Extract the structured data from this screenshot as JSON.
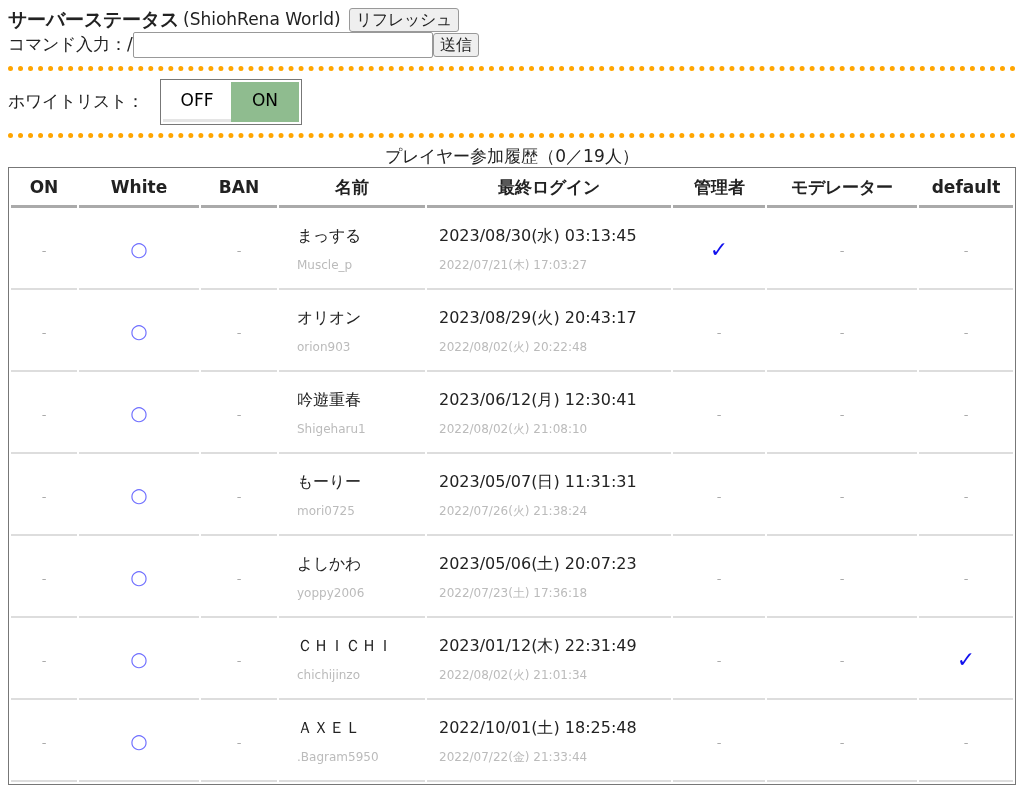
{
  "header": {
    "title": "サーバーステータス",
    "world": "(ShiohRena World)",
    "refresh_button": "リフレッシュ"
  },
  "command": {
    "label": "コマンド入力：/",
    "send_button": "送信"
  },
  "whitelist": {
    "label": "ホワイトリスト：",
    "options": [
      {
        "label": "OFF",
        "selected": false
      },
      {
        "label": "ON",
        "selected": true
      }
    ]
  },
  "table": {
    "caption": "プレイヤー参加履歴（0／19人）",
    "columns": [
      "ON",
      "White",
      "BAN",
      "名前",
      "最終ログイン",
      "管理者",
      "モデレーター",
      "default"
    ],
    "rows": [
      {
        "on": "-",
        "white": "○",
        "ban": "-",
        "name": "まっする",
        "id": "Muscle_p",
        "last_login": "2023/08/30(水) 03:13:45",
        "first_login": "2022/07/21(木) 17:03:27",
        "admin": "✓",
        "moderator": "-",
        "default": "-"
      },
      {
        "on": "-",
        "white": "○",
        "ban": "-",
        "name": "オリオン",
        "id": "orion903",
        "last_login": "2023/08/29(火) 20:43:17",
        "first_login": "2022/08/02(火) 20:22:48",
        "admin": "-",
        "moderator": "-",
        "default": "-"
      },
      {
        "on": "-",
        "white": "○",
        "ban": "-",
        "name": "吟遊重春",
        "id": "Shigeharu1",
        "last_login": "2023/06/12(月) 12:30:41",
        "first_login": "2022/08/02(火) 21:08:10",
        "admin": "-",
        "moderator": "-",
        "default": "-"
      },
      {
        "on": "-",
        "white": "○",
        "ban": "-",
        "name": "もーりー",
        "id": "mori0725",
        "last_login": "2023/05/07(日) 11:31:31",
        "first_login": "2022/07/26(火) 21:38:24",
        "admin": "-",
        "moderator": "-",
        "default": "-"
      },
      {
        "on": "-",
        "white": "○",
        "ban": "-",
        "name": "よしかわ",
        "id": "yoppy2006",
        "last_login": "2023/05/06(土) 20:07:23",
        "first_login": "2022/07/23(土) 17:36:18",
        "admin": "-",
        "moderator": "-",
        "default": "-"
      },
      {
        "on": "-",
        "white": "○",
        "ban": "-",
        "name": "ＣＨＩＣＨＩ",
        "id": "chichijinzo",
        "last_login": "2023/01/12(木) 22:31:49",
        "first_login": "2022/08/02(火) 21:01:34",
        "admin": "-",
        "moderator": "-",
        "default": "✓"
      },
      {
        "on": "-",
        "white": "○",
        "ban": "-",
        "name": "ＡＸＥＬ",
        "id": ".Bagram5950",
        "last_login": "2022/10/01(土) 18:25:48",
        "first_login": "2022/07/22(金) 21:33:44",
        "admin": "-",
        "moderator": "-",
        "default": "-"
      }
    ]
  }
}
